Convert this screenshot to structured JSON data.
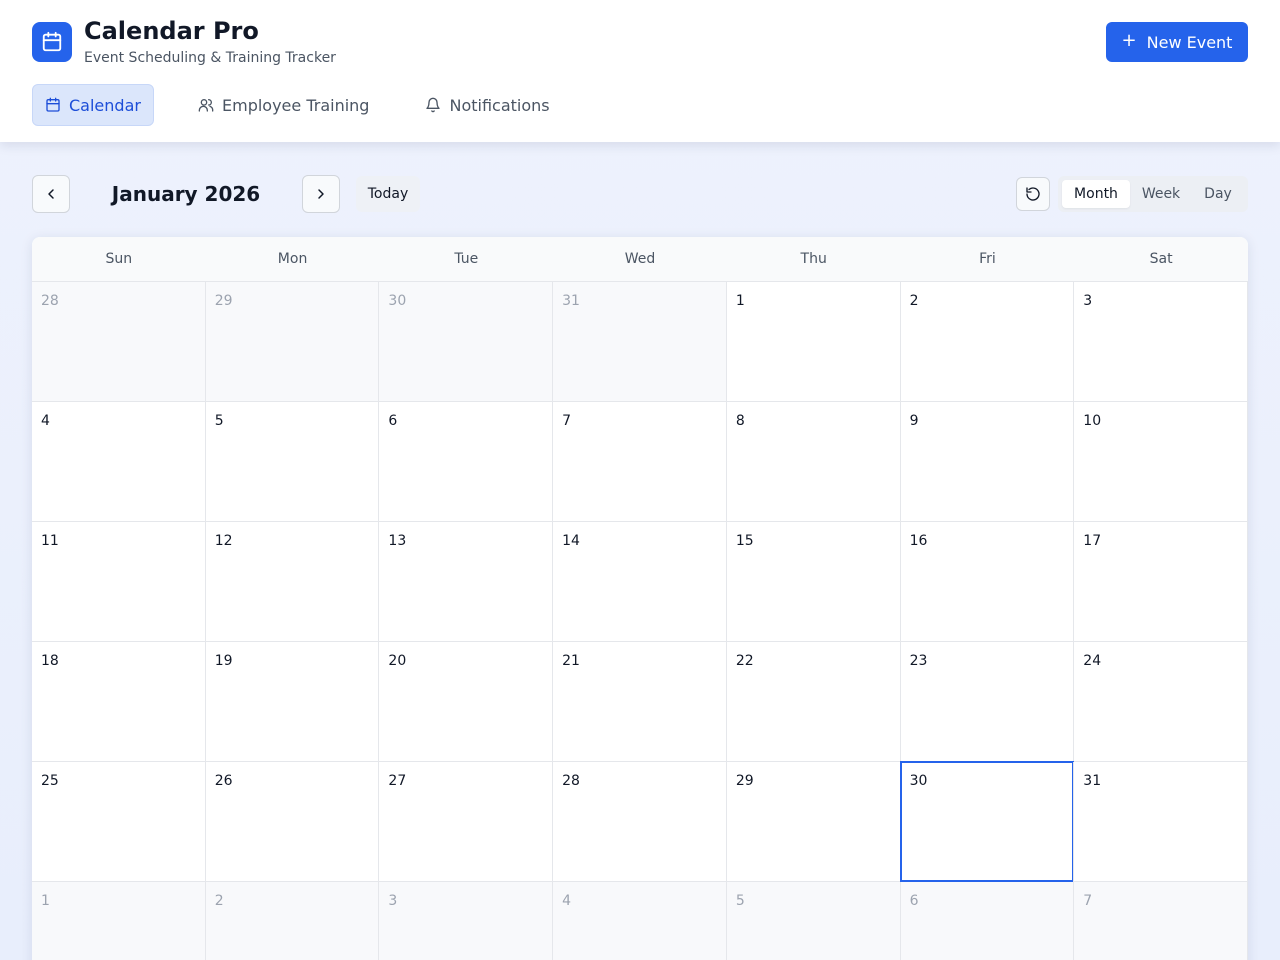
{
  "app": {
    "title": "Calendar Pro",
    "subtitle": "Event Scheduling & Training Tracker",
    "logo_icon": "calendar-icon",
    "accent_color": "#2563eb"
  },
  "header": {
    "new_event_label": "New Event",
    "new_event_icon": "plus-icon"
  },
  "nav": {
    "items": [
      {
        "label": "Calendar",
        "icon": "calendar-icon",
        "active": true
      },
      {
        "label": "Employee Training",
        "icon": "users-icon",
        "active": false
      },
      {
        "label": "Notifications",
        "icon": "bell-icon",
        "active": false
      }
    ]
  },
  "toolbar": {
    "month_label": "January 2026",
    "today_label": "Today",
    "prev_icon": "chevron-left-icon",
    "next_icon": "chevron-right-icon",
    "refresh_icon": "refresh-icon",
    "views": [
      {
        "label": "Month",
        "active": true
      },
      {
        "label": "Week",
        "active": false
      },
      {
        "label": "Day",
        "active": false
      }
    ]
  },
  "calendar": {
    "weekdays": [
      "Sun",
      "Mon",
      "Tue",
      "Wed",
      "Thu",
      "Fri",
      "Sat"
    ],
    "today": 30,
    "days": [
      {
        "n": "28",
        "other": true
      },
      {
        "n": "29",
        "other": true
      },
      {
        "n": "30",
        "other": true
      },
      {
        "n": "31",
        "other": true
      },
      {
        "n": "1"
      },
      {
        "n": "2"
      },
      {
        "n": "3"
      },
      {
        "n": "4"
      },
      {
        "n": "5"
      },
      {
        "n": "6"
      },
      {
        "n": "7"
      },
      {
        "n": "8"
      },
      {
        "n": "9"
      },
      {
        "n": "10"
      },
      {
        "n": "11"
      },
      {
        "n": "12"
      },
      {
        "n": "13"
      },
      {
        "n": "14"
      },
      {
        "n": "15"
      },
      {
        "n": "16"
      },
      {
        "n": "17"
      },
      {
        "n": "18"
      },
      {
        "n": "19"
      },
      {
        "n": "20"
      },
      {
        "n": "21"
      },
      {
        "n": "22"
      },
      {
        "n": "23"
      },
      {
        "n": "24"
      },
      {
        "n": "25"
      },
      {
        "n": "26"
      },
      {
        "n": "27"
      },
      {
        "n": "28"
      },
      {
        "n": "29"
      },
      {
        "n": "30",
        "today": true
      },
      {
        "n": "31"
      },
      {
        "n": "1",
        "other": true
      },
      {
        "n": "2",
        "other": true
      },
      {
        "n": "3",
        "other": true
      },
      {
        "n": "4",
        "other": true
      },
      {
        "n": "5",
        "other": true
      },
      {
        "n": "6",
        "other": true
      },
      {
        "n": "7",
        "other": true
      }
    ]
  }
}
